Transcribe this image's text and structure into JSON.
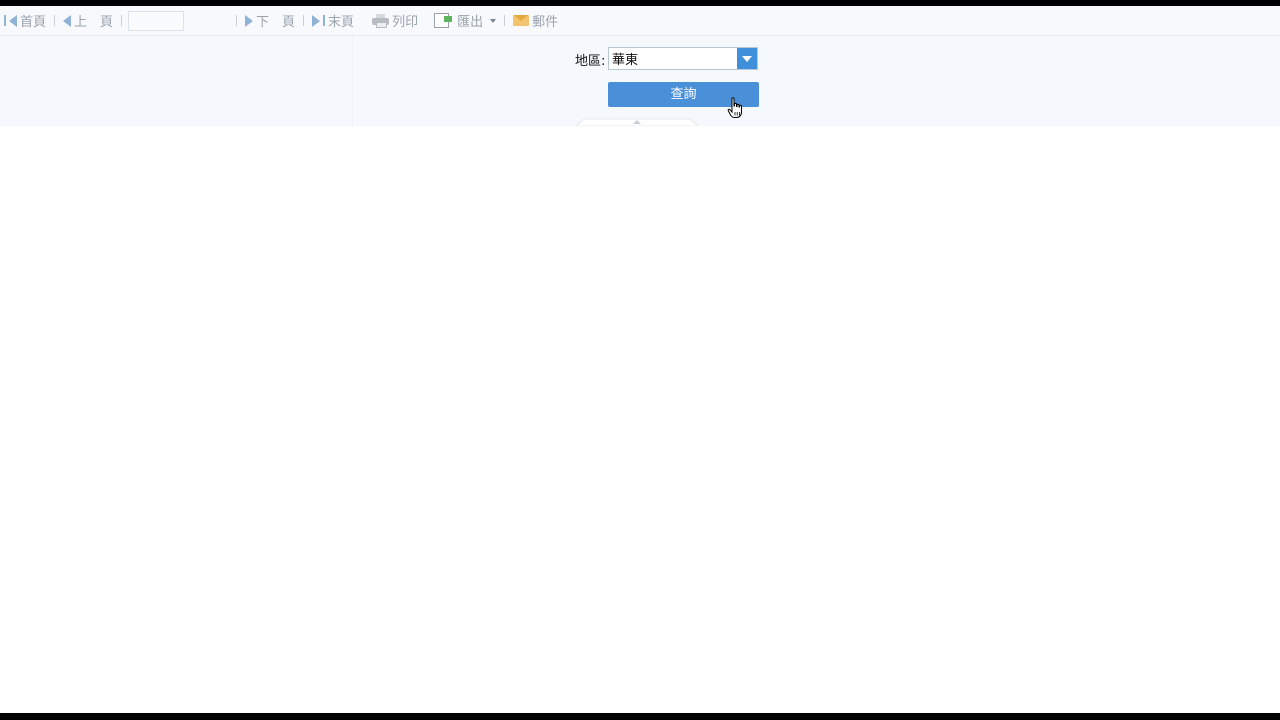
{
  "toolbar": {
    "first_page": "首頁",
    "prev_page": "上　頁",
    "page_input_value": "",
    "next_page": "下　頁",
    "last_page": "末頁",
    "print": "列印",
    "export": "匯出",
    "mail": "郵件"
  },
  "params": {
    "region_label": "地區:",
    "region_value": "華東",
    "query_button": "查詢"
  },
  "colors": {
    "toolbar_bg": "#f7f9fc",
    "panel_bg": "#f5f9fe",
    "accent": "#4a90d9"
  }
}
